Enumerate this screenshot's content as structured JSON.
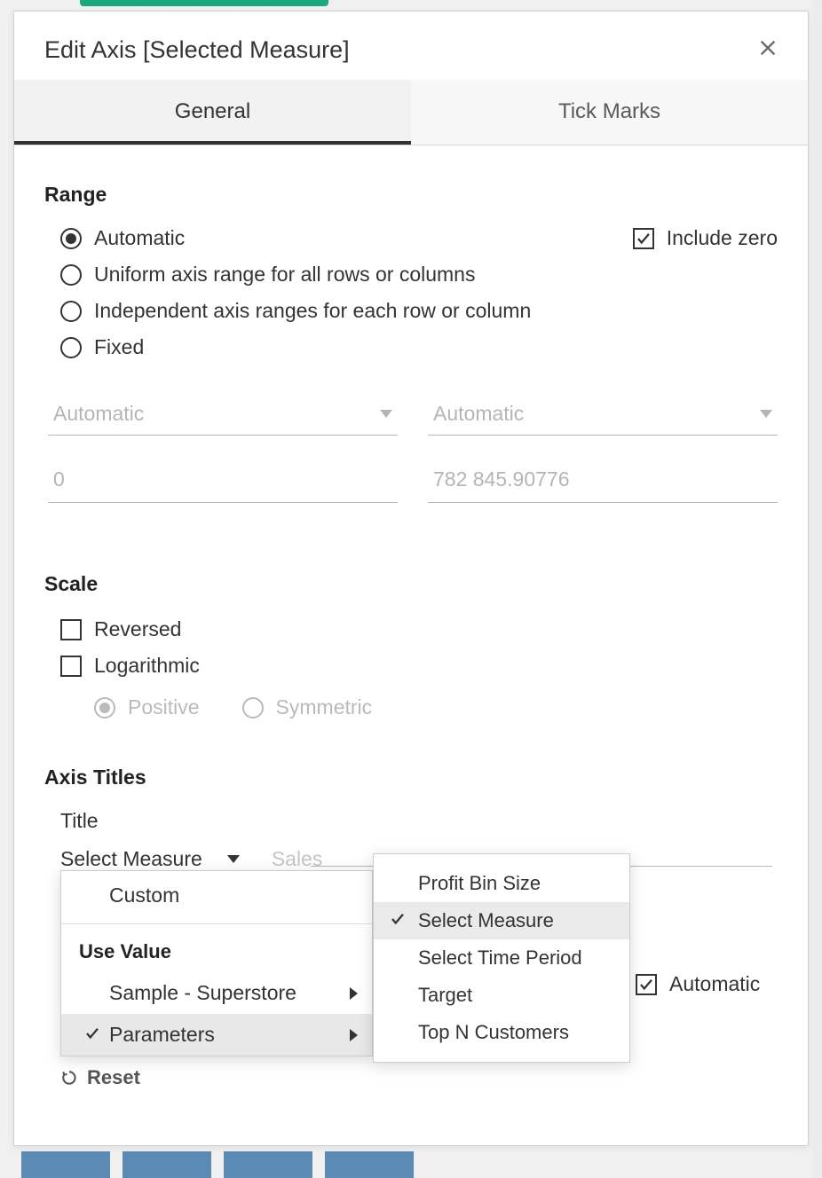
{
  "dialog": {
    "title": "Edit Axis [Selected Measure]",
    "tabs": {
      "general": "General",
      "tickmarks": "Tick Marks"
    }
  },
  "range": {
    "heading": "Range",
    "options": {
      "automatic": "Automatic",
      "uniform": "Uniform axis range for all rows or columns",
      "independent": "Independent axis ranges for each row or column",
      "fixed": "Fixed"
    },
    "include_zero": "Include zero",
    "start_mode": "Automatic",
    "end_mode": "Automatic",
    "start_value": "0",
    "end_value": "782 845.90776"
  },
  "scale": {
    "heading": "Scale",
    "reversed": "Reversed",
    "logarithmic": "Logarithmic",
    "positive": "Positive",
    "symmetric": "Symmetric"
  },
  "axis_titles": {
    "heading": "Axis Titles",
    "title_label": "Title",
    "title_value": "Select Measure",
    "subtitle_faded": "Sales",
    "automatic_label": "Automatic"
  },
  "flyout1": {
    "custom": "Custom",
    "use_value": "Use Value",
    "sample": "Sample - Superstore",
    "parameters": "Parameters"
  },
  "flyout2": {
    "items": [
      "Profit Bin Size",
      "Select Measure",
      "Select Time Period",
      "Target",
      "Top N Customers"
    ]
  },
  "reset": "Reset"
}
